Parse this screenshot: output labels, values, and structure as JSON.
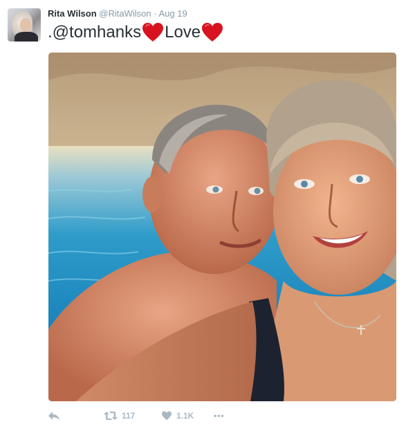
{
  "tweet": {
    "author": {
      "display_name": "Rita Wilson",
      "handle": "@RitaWilson",
      "separator": "·",
      "date": "Aug 19"
    },
    "text": {
      "mention": ".@tomhanks",
      "word": "Love",
      "emoji": "red-heart"
    },
    "actions": {
      "reply": {
        "icon": "reply-icon"
      },
      "retweet": {
        "icon": "retweet-icon",
        "count": "117"
      },
      "like": {
        "icon": "heart-icon",
        "count": "1.1K"
      },
      "more": {
        "icon": "more-icon",
        "label": "•••"
      }
    }
  },
  "colors": {
    "text": "#292f33",
    "secondary": "#8899a6",
    "icon": "#aab8c2",
    "heart_emoji": "#d8131f"
  }
}
